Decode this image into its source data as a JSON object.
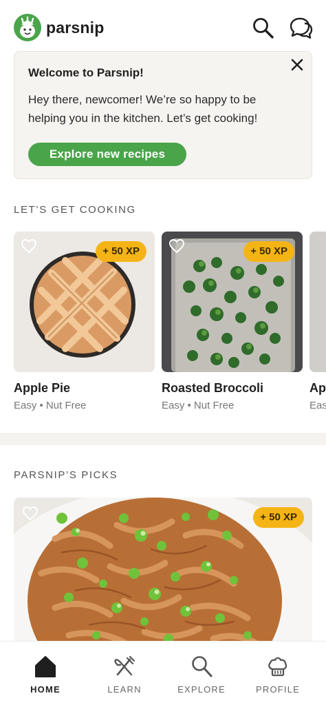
{
  "header": {
    "app_name": "parsnip",
    "icons": [
      "search-icon",
      "chat-icon"
    ]
  },
  "welcome": {
    "title": "Welcome to Parsnip!",
    "body": "Hey there, newcomer! We’re so happy to be helping you in the kitchen. Let’s get cooking!",
    "cta_label": "Explore new recipes"
  },
  "sections": {
    "cooking_title": "LET’S GET COOKING",
    "picks_title": "PARSNIP’S PICKS"
  },
  "recipes": [
    {
      "name": "Apple Pie",
      "meta": "Easy • Nut Free",
      "xp": "+ 50 XP"
    },
    {
      "name": "Roasted Broccoli",
      "meta": "Easy • Nut Free",
      "xp": "+ 50 XP"
    },
    {
      "name": "Ap",
      "meta": "Eas",
      "xp": ""
    }
  ],
  "pick": {
    "xp": "+ 50 XP"
  },
  "nav": [
    {
      "label": "HOME",
      "icon": "home-icon",
      "active": true
    },
    {
      "label": "LEARN",
      "icon": "fork-knife-icon",
      "active": false
    },
    {
      "label": "EXPLORE",
      "icon": "search-icon",
      "active": false
    },
    {
      "label": "PROFILE",
      "icon": "chef-hat-icon",
      "active": false
    }
  ],
  "colors": {
    "brand_green": "#4aa44a",
    "xp_badge": "#f5b416",
    "card_bg": "#f6f4f1"
  }
}
